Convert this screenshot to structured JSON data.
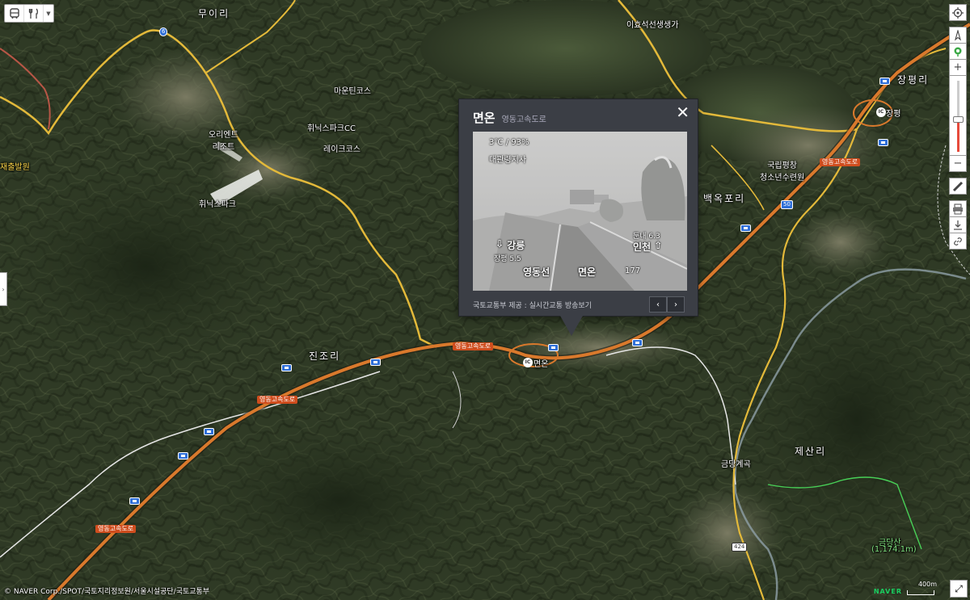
{
  "toolbar": {
    "icons": [
      "bus-icon",
      "restaurant-icon",
      "dropdown-icon"
    ]
  },
  "rail": {
    "icons": [
      "location-icon",
      "compass-icon",
      "street-view-icon",
      "zoom-in-icon",
      "zoom-out-icon",
      "ruler-icon",
      "print-icon",
      "download-icon",
      "link-icon"
    ],
    "zoom_level": 0.45
  },
  "places": {
    "muiri": "무이리",
    "jinjori": "진조리",
    "baekokpori": "백옥포리",
    "jangpyeongri": "장평리",
    "jesanri": "제산리",
    "jangpyeong_ic": "장평",
    "myeonon_ic": "면온",
    "orient_resort": "오리엔트\n리조트",
    "phoenix_park": "휘닉스파크",
    "phoenix_cc": "휘닉스파크CC",
    "mountain_course": "마운틴코스",
    "lake_course": "레이크코스",
    "ihyoseok": "이효석선생생가",
    "youth_center": "국립평창\n청소년수련원",
    "geumdang_valley": "금당계곡",
    "geumdangsan": "금당산",
    "geumdangsan_elev": "(1,174.1m)",
    "jaeulbalwon": "재출발원"
  },
  "route_badges": {
    "highway": "영동고속도로",
    "route_6": "6",
    "route_50": "50",
    "route_424": "424"
  },
  "popup": {
    "title": "면온",
    "subtitle": "영동고속도로",
    "close_icon": "close-icon",
    "feed": {
      "weather": "3℃ / 93%",
      "office": "대관령지사",
      "left_dest": "강릉",
      "left_dist": "장평 5.5",
      "right_dest": "인천",
      "right_dist": "둔내 6.3",
      "line": "영동선",
      "location": "면온",
      "km": "177"
    },
    "footer": "국토교통부 제공 : 실시간교통 방송보기",
    "prev_label": "‹",
    "next_label": "›"
  },
  "copyright": "© NAVER Corp./SPOT/국토지리정보원/서울시설공단/국토교통부",
  "scale": {
    "brand": "NAVER",
    "value": "400m"
  }
}
